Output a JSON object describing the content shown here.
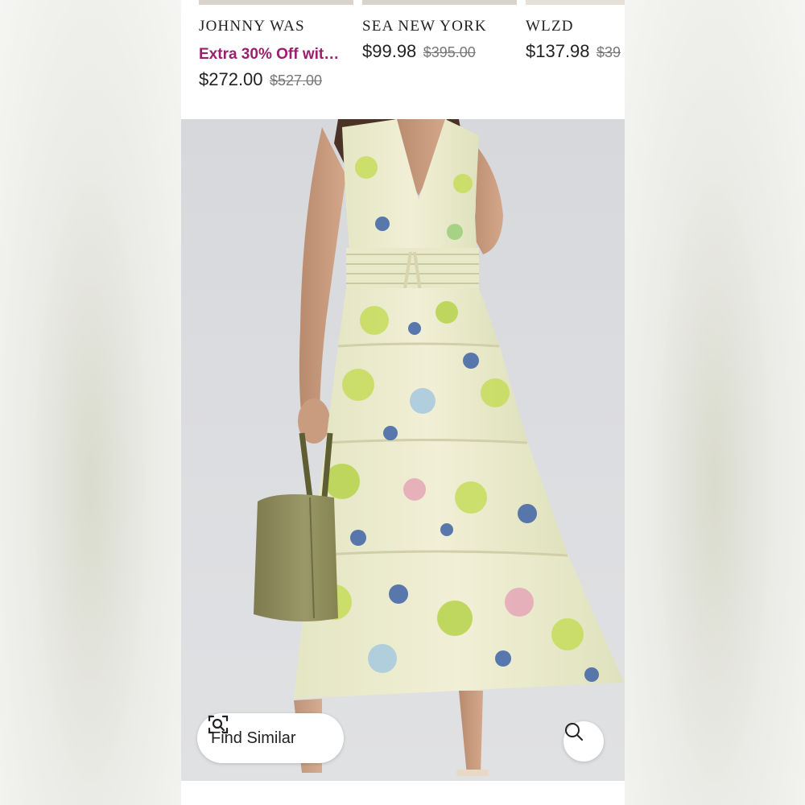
{
  "recommendations": [
    {
      "brand": "JOHNNY WAS",
      "promo": "Extra 30% Off wit…",
      "sale_price": "$272.00",
      "original_price": "$527.00"
    },
    {
      "brand": "SEA NEW YORK",
      "sale_price": "$99.98",
      "original_price": "$395.00"
    },
    {
      "brand": "WLZD",
      "sale_price": "$137.98",
      "original_price": "$39"
    }
  ],
  "actions": {
    "find_similar_label": "Find Similar",
    "find_similar_icon": "scan-search-icon",
    "zoom_icon": "magnifier-icon"
  },
  "colors": {
    "promo": "#9c1f6e",
    "dress_base": "#eceacb",
    "dress_accent_green": "#c7dc5a",
    "dress_accent_blue": "#3f63a6",
    "bag": "#8c8a5c"
  }
}
